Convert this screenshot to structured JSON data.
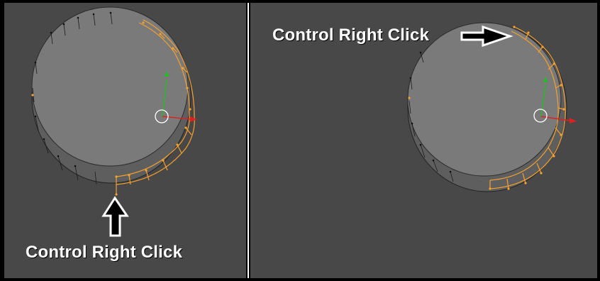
{
  "panels": {
    "left": {
      "caption": "Control Right Click"
    },
    "right": {
      "caption": "Control Right Click"
    }
  },
  "colors": {
    "background": "#484848",
    "face": "#787878",
    "selected_edge": "#f5a030",
    "unselected_edge": "#000000",
    "x_axis": "#e02020",
    "y_axis": "#20c020",
    "arrow_fill": "#000000",
    "arrow_outline": "#ffffff"
  },
  "icons": {
    "pointer_up": "arrow-up-icon",
    "pointer_right": "arrow-right-icon",
    "transform_widget": "transform-gizmo-icon"
  }
}
